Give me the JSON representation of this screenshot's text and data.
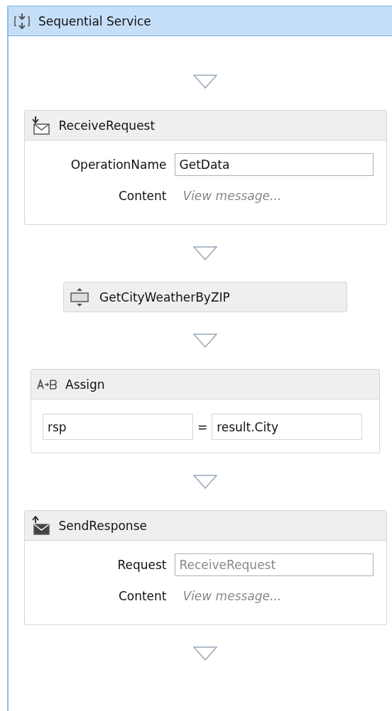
{
  "sequence": {
    "title": "Sequential Service"
  },
  "activities": [
    {
      "kind": "receive",
      "title": "ReceiveRequest",
      "rows": [
        {
          "label": "OperationName",
          "kind": "input",
          "value": "GetData"
        },
        {
          "label": "Content",
          "kind": "link",
          "value": "View message..."
        }
      ]
    },
    {
      "kind": "invoke",
      "title": "GetCityWeatherByZIP"
    },
    {
      "kind": "assign",
      "title": "Assign",
      "to": "rsp",
      "operator": "=",
      "value": "result.City"
    },
    {
      "kind": "send",
      "title": "SendResponse",
      "rows": [
        {
          "label": "Request",
          "kind": "input",
          "placeholder": "ReceiveRequest"
        },
        {
          "label": "Content",
          "kind": "link",
          "value": "View message..."
        }
      ]
    }
  ]
}
